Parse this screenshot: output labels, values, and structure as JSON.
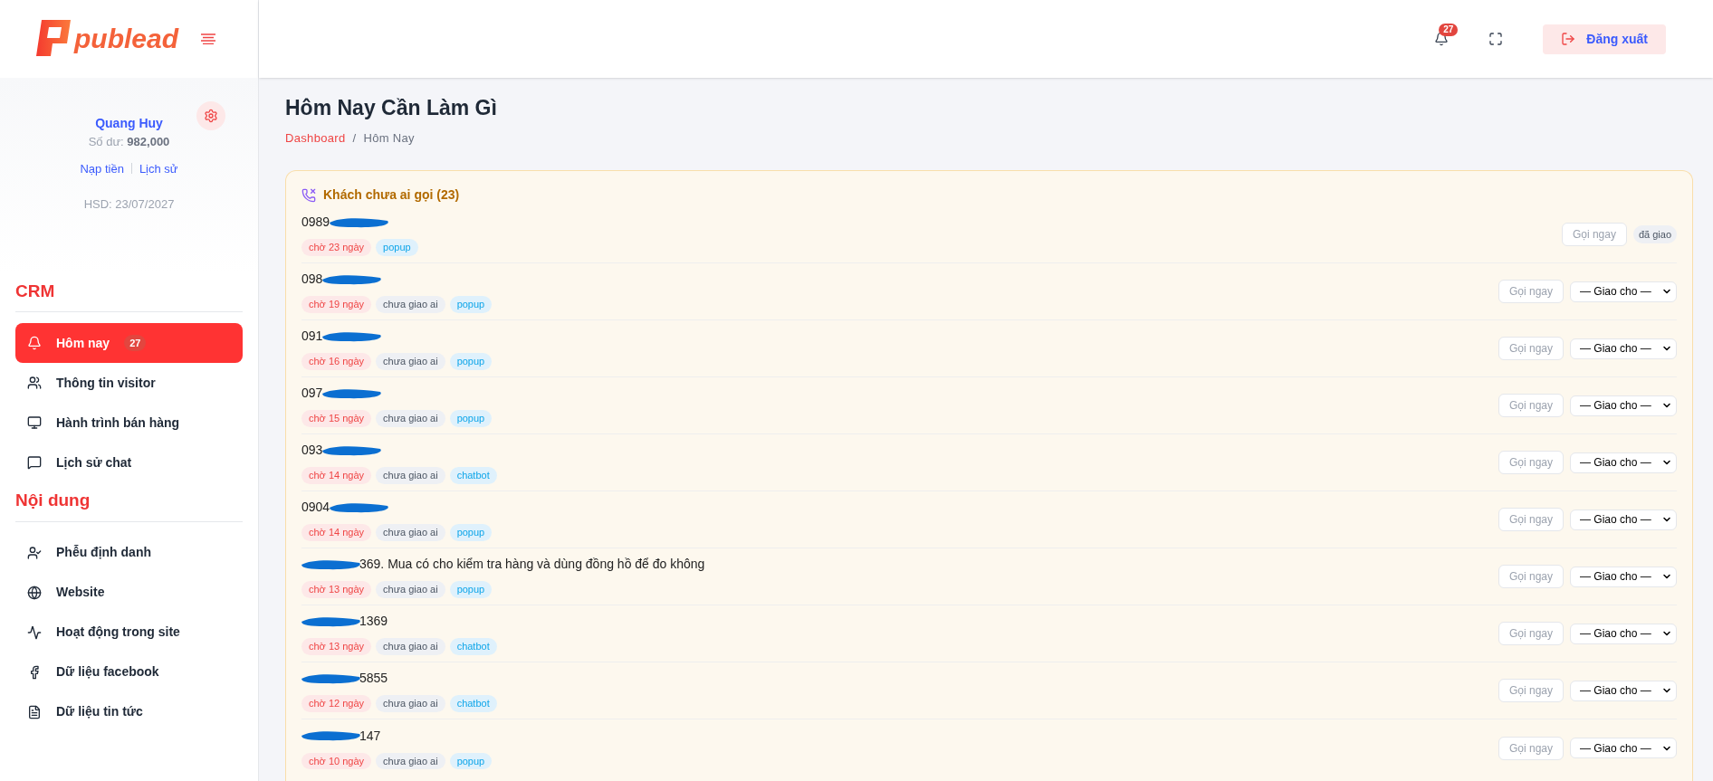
{
  "logo": {
    "text": "publead"
  },
  "user": {
    "name": "Quang Huy",
    "balance_label": "Số dư:",
    "balance": "982,000",
    "links": [
      "Nạp tiền",
      "Lịch sử"
    ],
    "expiry": "HSD: 23/07/2027"
  },
  "header": {
    "notification_count": "27",
    "logout": "Đăng xuất"
  },
  "sidebar": {
    "sections": [
      {
        "title": "CRM",
        "items": [
          {
            "label": "Hôm nay",
            "badge": "27",
            "selected": true
          },
          {
            "label": "Thông tin visitor",
            "selected": false
          },
          {
            "label": "Hành trình bán hàng",
            "selected": false
          },
          {
            "label": "Lịch sử chat",
            "selected": false
          }
        ]
      },
      {
        "title": "Nội dung",
        "items": [
          {
            "label": "Phễu định danh",
            "selected": false
          },
          {
            "label": "Website",
            "selected": false
          },
          {
            "label": "Hoạt động trong site",
            "selected": false
          },
          {
            "label": "Dữ liệu facebook",
            "selected": false
          },
          {
            "label": "Dữ liệu tin tức",
            "selected": false
          }
        ]
      }
    ]
  },
  "page": {
    "title": "Hôm Nay Cần Làm Gì",
    "breadcrumb": [
      "Dashboard",
      "Hôm Nay"
    ],
    "breadcrumb_separator": "/"
  },
  "card": {
    "title": "Khách chưa ai gọi (23)",
    "rows": [
      {
        "text_before": "0989",
        "text_after": "",
        "tags": [
          {
            "kind": "wait",
            "label": "chờ 23 ngày"
          },
          {
            "kind": "source",
            "label": "popup"
          }
        ],
        "call": "Gọi ngay",
        "assign": {
          "kind": "badge",
          "label": "đã giao"
        }
      },
      {
        "text_before": "098",
        "text_after": "",
        "tags": [
          {
            "kind": "wait",
            "label": "chờ 19 ngày"
          },
          {
            "kind": "status",
            "label": "chưa giao ai"
          },
          {
            "kind": "source",
            "label": "popup"
          }
        ],
        "call": "Gọi ngay",
        "assign": {
          "kind": "select",
          "label": "— Giao cho —"
        }
      },
      {
        "text_before": "091",
        "text_after": "",
        "tags": [
          {
            "kind": "wait",
            "label": "chờ 16 ngày"
          },
          {
            "kind": "status",
            "label": "chưa giao ai"
          },
          {
            "kind": "source",
            "label": "popup"
          }
        ],
        "call": "Gọi ngay",
        "assign": {
          "kind": "select",
          "label": "— Giao cho —"
        }
      },
      {
        "text_before": "097",
        "text_after": "",
        "tags": [
          {
            "kind": "wait",
            "label": "chờ 15 ngày"
          },
          {
            "kind": "status",
            "label": "chưa giao ai"
          },
          {
            "kind": "source",
            "label": "popup"
          }
        ],
        "call": "Gọi ngay",
        "assign": {
          "kind": "select",
          "label": "— Giao cho —"
        }
      },
      {
        "text_before": "093",
        "text_after": "",
        "tags": [
          {
            "kind": "wait",
            "label": "chờ 14 ngày"
          },
          {
            "kind": "status",
            "label": "chưa giao ai"
          },
          {
            "kind": "source",
            "label": "chatbot"
          }
        ],
        "call": "Gọi ngay",
        "assign": {
          "kind": "select",
          "label": "— Giao cho —"
        }
      },
      {
        "text_before": "0904",
        "text_after": "",
        "tags": [
          {
            "kind": "wait",
            "label": "chờ 14 ngày"
          },
          {
            "kind": "status",
            "label": "chưa giao ai"
          },
          {
            "kind": "source",
            "label": "popup"
          }
        ],
        "call": "Gọi ngay",
        "assign": {
          "kind": "select",
          "label": "— Giao cho —"
        }
      },
      {
        "text_before": "",
        "text_after": "369. Mua có cho kiểm tra hàng và dùng đồng hồ để đo không",
        "tags": [
          {
            "kind": "wait",
            "label": "chờ 13 ngày"
          },
          {
            "kind": "status",
            "label": "chưa giao ai"
          },
          {
            "kind": "source",
            "label": "popup"
          }
        ],
        "call": "Gọi ngay",
        "assign": {
          "kind": "select",
          "label": "— Giao cho —"
        }
      },
      {
        "text_before": "",
        "text_after": "1369",
        "tags": [
          {
            "kind": "wait",
            "label": "chờ 13 ngày"
          },
          {
            "kind": "status",
            "label": "chưa giao ai"
          },
          {
            "kind": "source",
            "label": "chatbot"
          }
        ],
        "call": "Gọi ngay",
        "assign": {
          "kind": "select",
          "label": "— Giao cho —"
        }
      },
      {
        "text_before": "",
        "text_after": "5855",
        "tags": [
          {
            "kind": "wait",
            "label": "chờ 12 ngày"
          },
          {
            "kind": "status",
            "label": "chưa giao ai"
          },
          {
            "kind": "source",
            "label": "chatbot"
          }
        ],
        "call": "Gọi ngay",
        "assign": {
          "kind": "select",
          "label": "— Giao cho —"
        }
      },
      {
        "text_before": "",
        "text_after": "147",
        "tags": [
          {
            "kind": "wait",
            "label": "chờ 10 ngày"
          },
          {
            "kind": "status",
            "label": "chưa giao ai"
          },
          {
            "kind": "source",
            "label": "popup"
          }
        ],
        "call": "Gọi ngay",
        "assign": {
          "kind": "select",
          "label": "— Giao cho —"
        }
      }
    ]
  }
}
